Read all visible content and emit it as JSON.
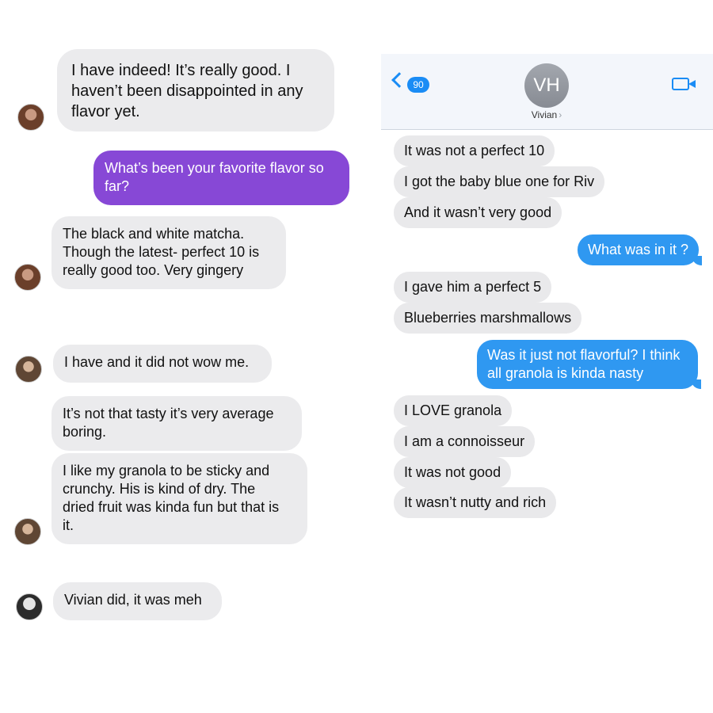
{
  "left_thread": {
    "messages": [
      {
        "text": "I have indeed! It’s really good. I\nhaven’t been disappointed in any\nflavor yet."
      },
      {
        "text": "What’s been your favorite flavor so\nfar?"
      },
      {
        "text": "The black and white matcha.\nThough the latest- perfect 10 is\nreally good too.  Very gingery"
      },
      {
        "text": "I have and it did not wow me."
      },
      {
        "text": "It’s not that tasty it’s very average\nboring."
      },
      {
        "text": "I like my granola to be sticky and\ncrunchy. His is kind of dry. The\ndried fruit was kinda fun but that is\nit."
      },
      {
        "text": "Vivian did, it was meh"
      }
    ],
    "colors": {
      "incoming_bubble": "#ebebed",
      "outgoing_bubble": "#8748d6"
    }
  },
  "imessage": {
    "header": {
      "back_badge": "90",
      "contact_initials": "VH",
      "contact_name": "Vivian",
      "back_icon": "chevron-left-icon",
      "video_icon": "video-camera-icon"
    },
    "messages": [
      {
        "text": "It was not a perfect 10",
        "dir": "in"
      },
      {
        "text": "I got the baby blue one for Riv",
        "dir": "in"
      },
      {
        "text": "And it wasn’t very good",
        "dir": "in"
      },
      {
        "text": "What was in it ?",
        "dir": "out"
      },
      {
        "text": "I gave him a perfect 5",
        "dir": "in"
      },
      {
        "text": "Blueberries marshmallows",
        "dir": "in"
      },
      {
        "text": "Was it just not flavorful? I think\nall granola is kinda nasty",
        "dir": "out"
      },
      {
        "text": "I LOVE granola",
        "dir": "in"
      },
      {
        "text": "I am a connoisseur",
        "dir": "in"
      },
      {
        "text": "It was not good",
        "dir": "in"
      },
      {
        "text": "It wasn’t nutty and rich",
        "dir": "in"
      }
    ],
    "colors": {
      "accent": "#1a8cf5",
      "outgoing_bubble": "#2f98f1",
      "incoming_bubble": "#e9e9eb"
    }
  }
}
